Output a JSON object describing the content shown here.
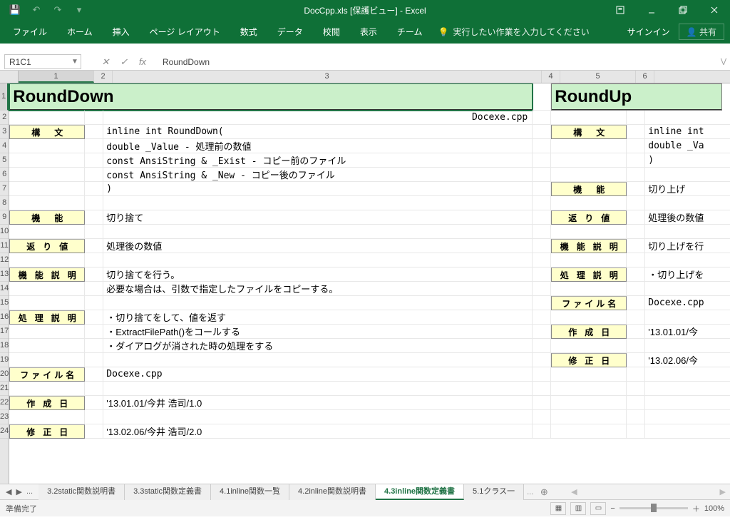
{
  "title": "DocCpp.xls  [保護ビュー] - Excel",
  "qat": {
    "save": "save",
    "undo": "undo",
    "redo": "redo",
    "customize": "customize"
  },
  "win": {
    "ribbonopt": "ribbon-options",
    "min": "minimize",
    "max": "restore",
    "close": "close"
  },
  "ribbon": [
    "ファイル",
    "ホーム",
    "挿入",
    "ページ レイアウト",
    "数式",
    "データ",
    "校閲",
    "表示",
    "チーム"
  ],
  "tellme": "実行したい作業を入力してください",
  "signin": "サインイン",
  "share": "共有",
  "namebox": "R1C1",
  "formula": "RoundDown",
  "col_labels": [
    "1",
    "2",
    "3",
    "4",
    "5",
    "6"
  ],
  "rows": {
    "left": {
      "title": "RoundDown",
      "file": "Docexe.cpp",
      "labels": [
        "構　文",
        "機　能",
        "返 り 値",
        "機 能 説 明",
        "処 理 説 明",
        "ファイル名",
        "作 成 日",
        "修 正 日"
      ],
      "body": {
        "signature": "inline int RoundDown(",
        "p1": " double            _Value  - 処理前の数値",
        "p2": " const AnsiString & _Exist  - コピー前のファイル",
        "p3": " const AnsiString & _New    - コピー後のファイル",
        "p4": ")",
        "func": "切り捨て",
        "ret": "処理後の数値",
        "desc1": "切り捨てを行う。",
        "desc2": "必要な場合は、引数で指定したファイルをコピーする。",
        "proc1": "・切り捨てをして、値を返す",
        "proc2": "・ExtractFilePath()をコールする",
        "proc3": "・ダイアログが消された時の処理をする",
        "fname": "Docexe.cpp",
        "created": "'13.01.01/今井 浩司/1.0",
        "modified": "'13.02.06/今井 浩司/2.0"
      }
    },
    "right": {
      "title": "RoundUp",
      "labels": [
        "構　文",
        "機　能",
        "返 り 値",
        "機 能 説 明",
        "処 理 説 明",
        "ファイル名",
        "作 成 日",
        "修 正 日"
      ],
      "body": {
        "signature": "inline int",
        "p1": " double _Va",
        "p2": ")",
        "func": "切り上げ",
        "ret": "処理後の数値",
        "desc1": "切り上げを行",
        "proc1": "・切り上げを",
        "fname": "Docexe.cpp",
        "created": "'13.01.01/今",
        "modified": "'13.02.06/今"
      }
    }
  },
  "tabs": [
    "3.2static関数説明書",
    "3.3static関数定義書",
    "4.1inline関数一覧",
    "4.2inline関数説明書",
    "4.3inline関数定義書",
    "5.1クラス一"
  ],
  "tabs_more": "...",
  "active_tab": 4,
  "status": "準備完了",
  "zoom": "100%"
}
